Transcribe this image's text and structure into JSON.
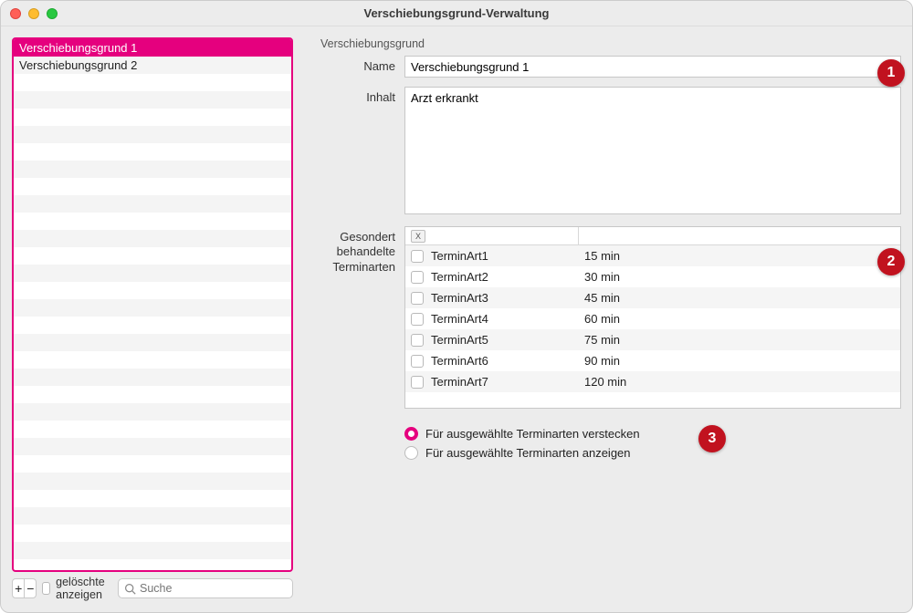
{
  "window": {
    "title": "Verschiebungsgrund-Verwaltung"
  },
  "sidebar": {
    "items": [
      {
        "label": "Verschiebungsgrund 1",
        "selected": true
      },
      {
        "label": "Verschiebungsgrund 2",
        "selected": false
      }
    ],
    "footer": {
      "add": "+",
      "remove": "−",
      "show_deleted_label": "gelöschte anzeigen",
      "search_placeholder": "Suche"
    }
  },
  "panel": {
    "section_title": "Verschiebungsgrund",
    "name_label": "Name",
    "name_value": "Verschiebungsgrund 1",
    "content_label": "Inhalt",
    "content_value": "Arzt erkrankt",
    "terminarten_label_line1": "Gesondert",
    "terminarten_label_line2": "behandelte",
    "terminarten_label_line3": "Terminarten",
    "table_header_clear": "X",
    "terminarten": [
      {
        "name": "TerminArt1",
        "duration": "15 min"
      },
      {
        "name": "TerminArt2",
        "duration": "30 min"
      },
      {
        "name": "TerminArt3",
        "duration": "45 min"
      },
      {
        "name": "TerminArt4",
        "duration": "60 min"
      },
      {
        "name": "TerminArt5",
        "duration": "75 min"
      },
      {
        "name": "TerminArt6",
        "duration": "90 min"
      },
      {
        "name": "TerminArt7",
        "duration": "120 min"
      }
    ],
    "radio_hide_label": "Für ausgewählte Terminarten verstecken",
    "radio_show_label": "Für ausgewählte Terminarten anzeigen",
    "radio_selected": "hide"
  },
  "annotations": {
    "b1": "1",
    "b2": "2",
    "b3": "3"
  }
}
